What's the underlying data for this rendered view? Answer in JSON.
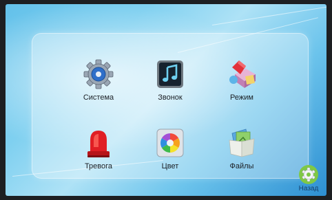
{
  "menu": {
    "items": [
      {
        "label": "Система",
        "icon": "gear-system-icon"
      },
      {
        "label": "Звонок",
        "icon": "music-note-icon"
      },
      {
        "label": "Режим",
        "icon": "mode-shapes-icon"
      },
      {
        "label": "Тревога",
        "icon": "alarm-siren-icon"
      },
      {
        "label": "Цвет",
        "icon": "color-wheel-icon"
      },
      {
        "label": "Файлы",
        "icon": "files-folder-icon"
      }
    ]
  },
  "back": {
    "label": "Назад",
    "icon": "back-gear-icon"
  }
}
